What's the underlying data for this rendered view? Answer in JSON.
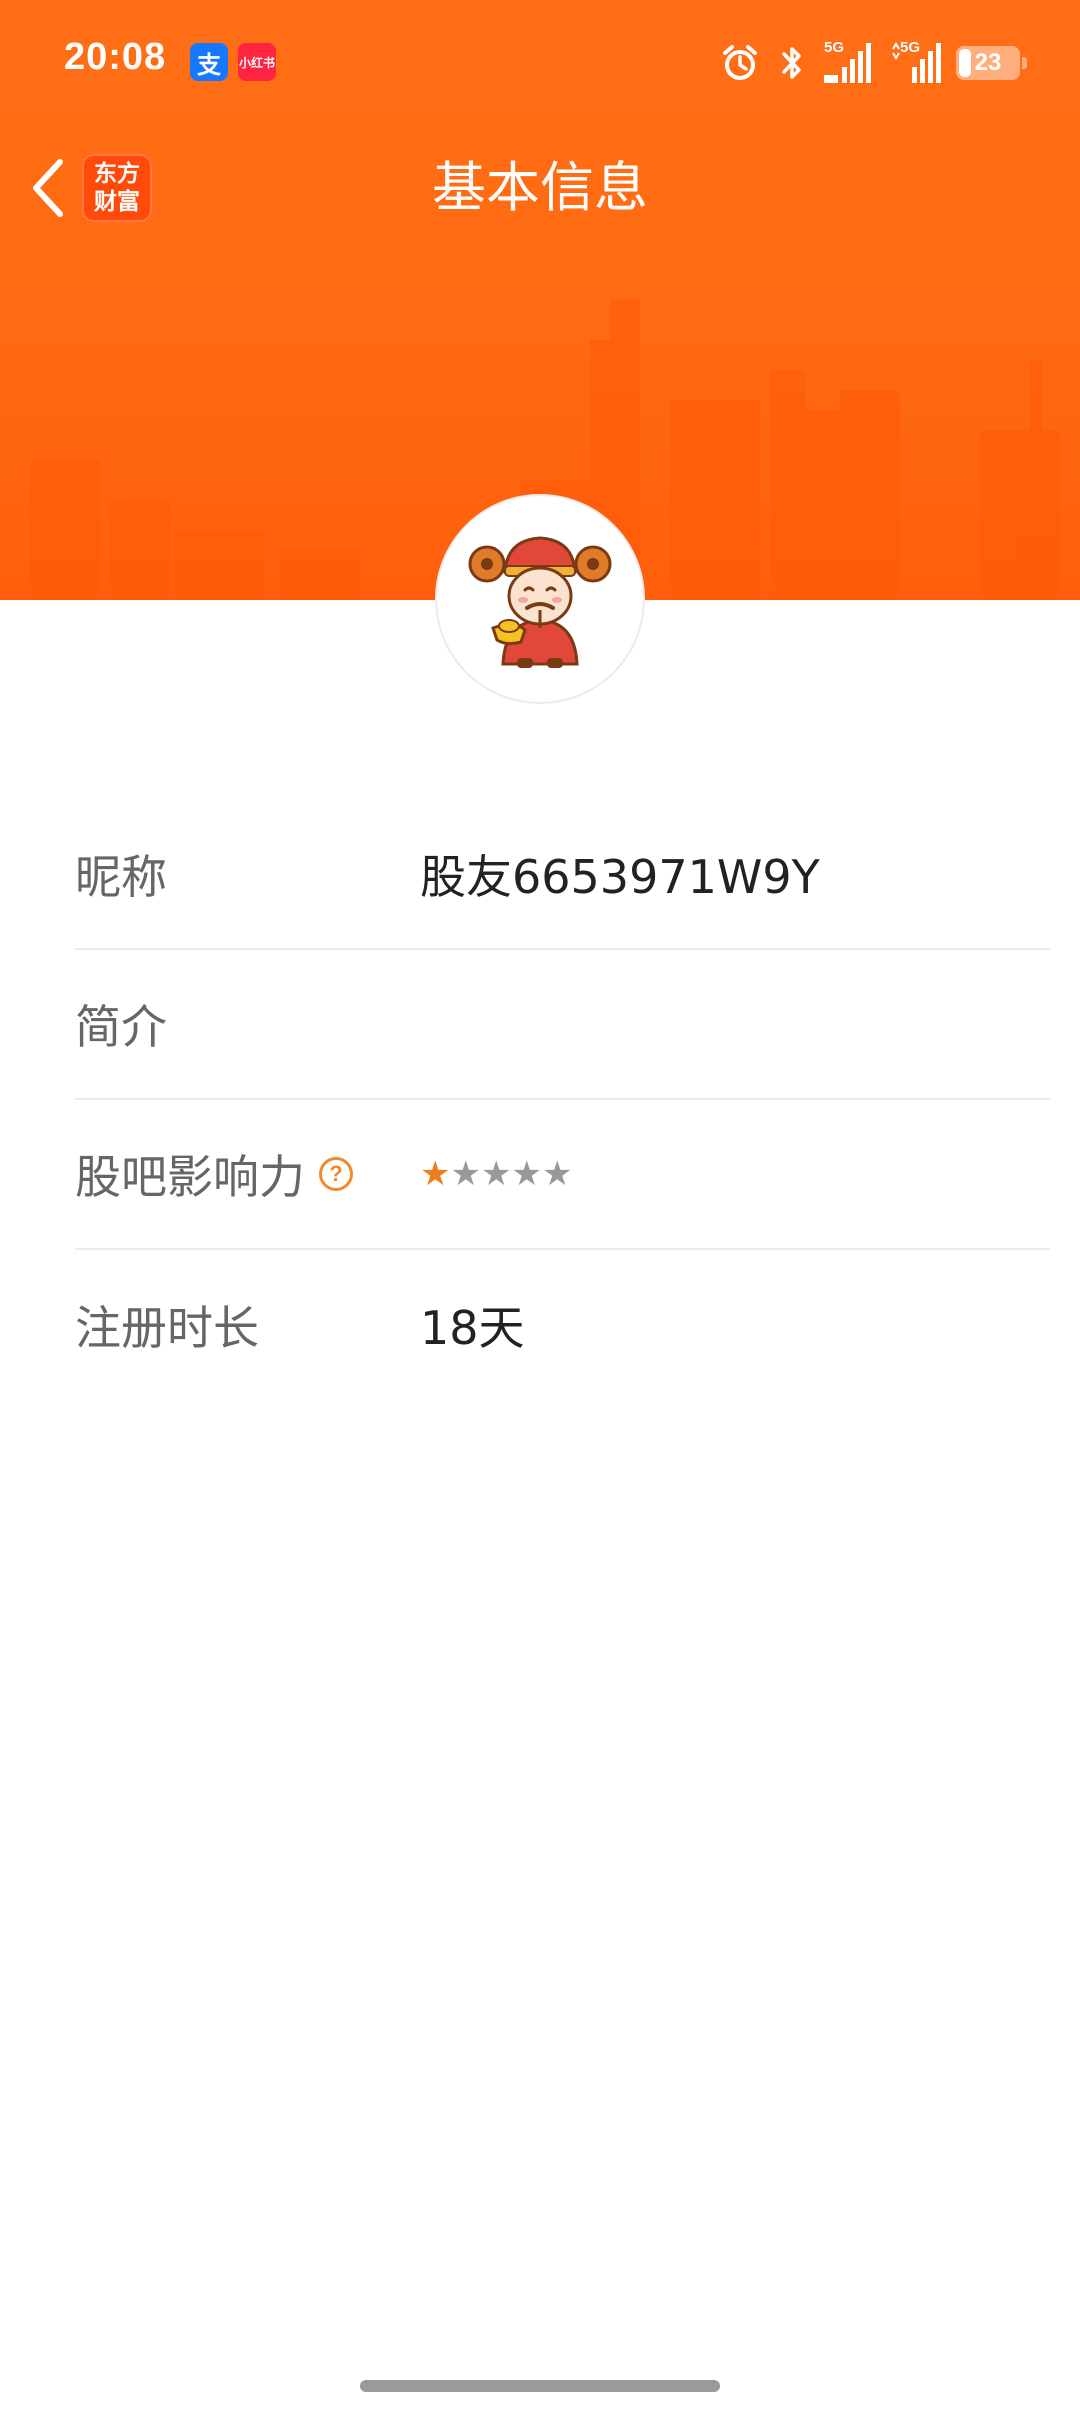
{
  "status_bar": {
    "time": "20:08",
    "alipay_badge": "支",
    "rednote_badge": "小红书",
    "signal_1_label": "5G",
    "signal_2_label": "5G",
    "battery_level": "23",
    "icons": [
      "alarm-icon",
      "bluetooth-icon",
      "signal-icon",
      "signal-icon",
      "battery-icon"
    ]
  },
  "header": {
    "title": "基本信息",
    "logo_line1": "东方",
    "logo_line2": "财富",
    "accent_color": "#ff6a12"
  },
  "profile": {
    "rows": [
      {
        "label": "昵称",
        "value": "股友6653971W9Y"
      },
      {
        "label": "简介",
        "value": ""
      },
      {
        "label": "股吧影响力",
        "help_icon": "?",
        "rating": 1,
        "rating_max": 5
      },
      {
        "label": "注册时长",
        "value": "18天"
      }
    ]
  },
  "colors": {
    "star_on": "#ef7d1e",
    "star_off": "#999999",
    "label": "#666666",
    "value": "#222222"
  }
}
